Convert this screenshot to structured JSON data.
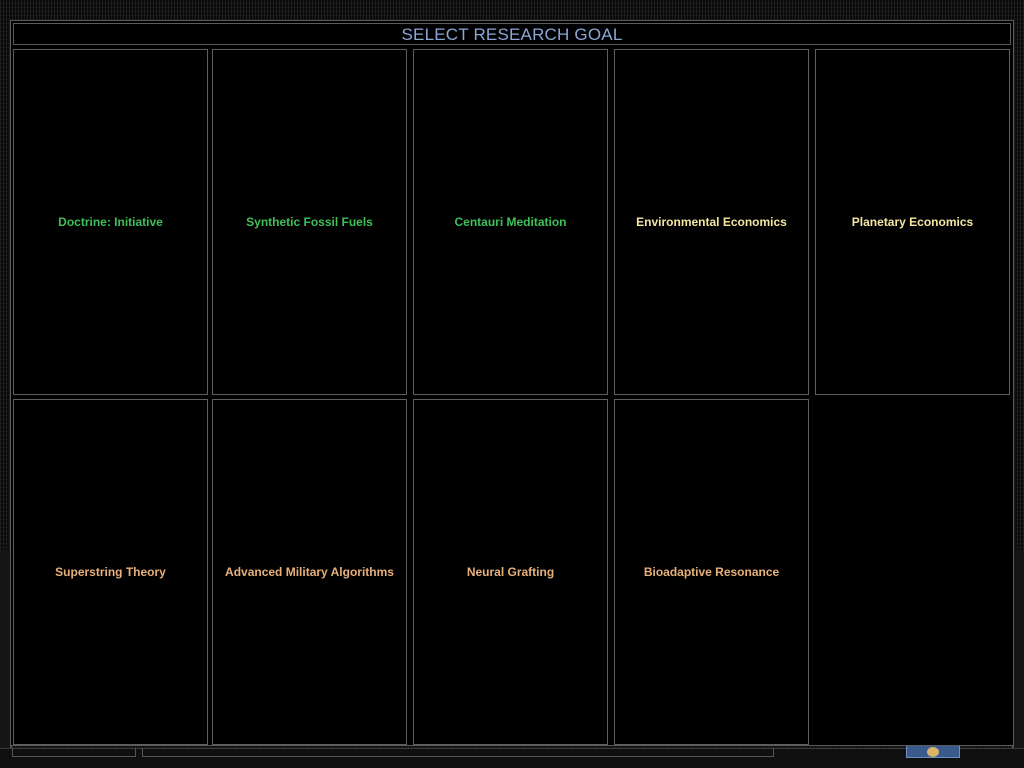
{
  "dialog": {
    "title": "SELECT RESEARCH GOAL"
  },
  "colors": {
    "title": "#8aa6d6",
    "green": "#3fbf5a",
    "yellow": "#f2e6a2",
    "orange": "#e6b07a",
    "border": "#5e5e5e"
  },
  "goals": [
    {
      "label": "Doctrine: Initiative",
      "color": "#3fbf5a"
    },
    {
      "label": "Synthetic Fossil Fuels",
      "color": "#3fbf5a"
    },
    {
      "label": "Centauri Meditation",
      "color": "#3fbf5a"
    },
    {
      "label": "Environmental Economics",
      "color": "#f2e6a2"
    },
    {
      "label": "Planetary Economics",
      "color": "#f2e6a2"
    },
    {
      "label": "Superstring Theory",
      "color": "#e6b07a"
    },
    {
      "label": "Advanced Military Algorithms",
      "color": "#e6b07a"
    },
    {
      "label": "Neural Grafting",
      "color": "#e6b07a"
    },
    {
      "label": "Bioadaptive Resonance",
      "color": "#e6b07a"
    }
  ]
}
